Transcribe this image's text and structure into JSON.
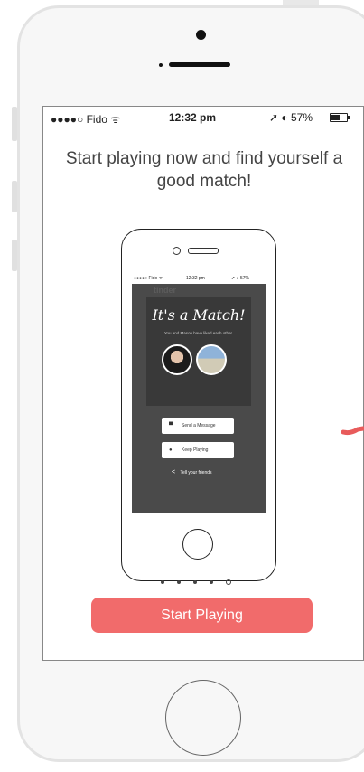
{
  "status_bar": {
    "carrier": "●●●●○ Fido ᯤ",
    "time": "12:32 pm",
    "right": "➚ ◐ 57%"
  },
  "headline": "Start playing now and find yourself a good match!",
  "mini_screen": {
    "status_carrier": "●●●●○ Fido ᯤ",
    "status_time": "12:32 pm",
    "status_right": "➚ ◐ 57%",
    "app_name": "tinder",
    "match_title": "It's a Match!",
    "match_subtitle": "You and Mason have liked each other.",
    "send_message": "Send a Message",
    "keep_playing": "Keep Playing",
    "tell_friends": "Tell your friends"
  },
  "pagination": {
    "total": 5,
    "active_index": 4
  },
  "start_button": "Start Playing",
  "colors": {
    "accent": "#f16b6b",
    "dark_screen": "#4a4a4a",
    "text": "#444444",
    "swoosh": "#e85b5b"
  },
  "icons": [
    "wifi-icon",
    "location-arrow-icon",
    "alarm-icon",
    "battery-icon",
    "message-icon",
    "person-icon",
    "share-icon"
  ]
}
